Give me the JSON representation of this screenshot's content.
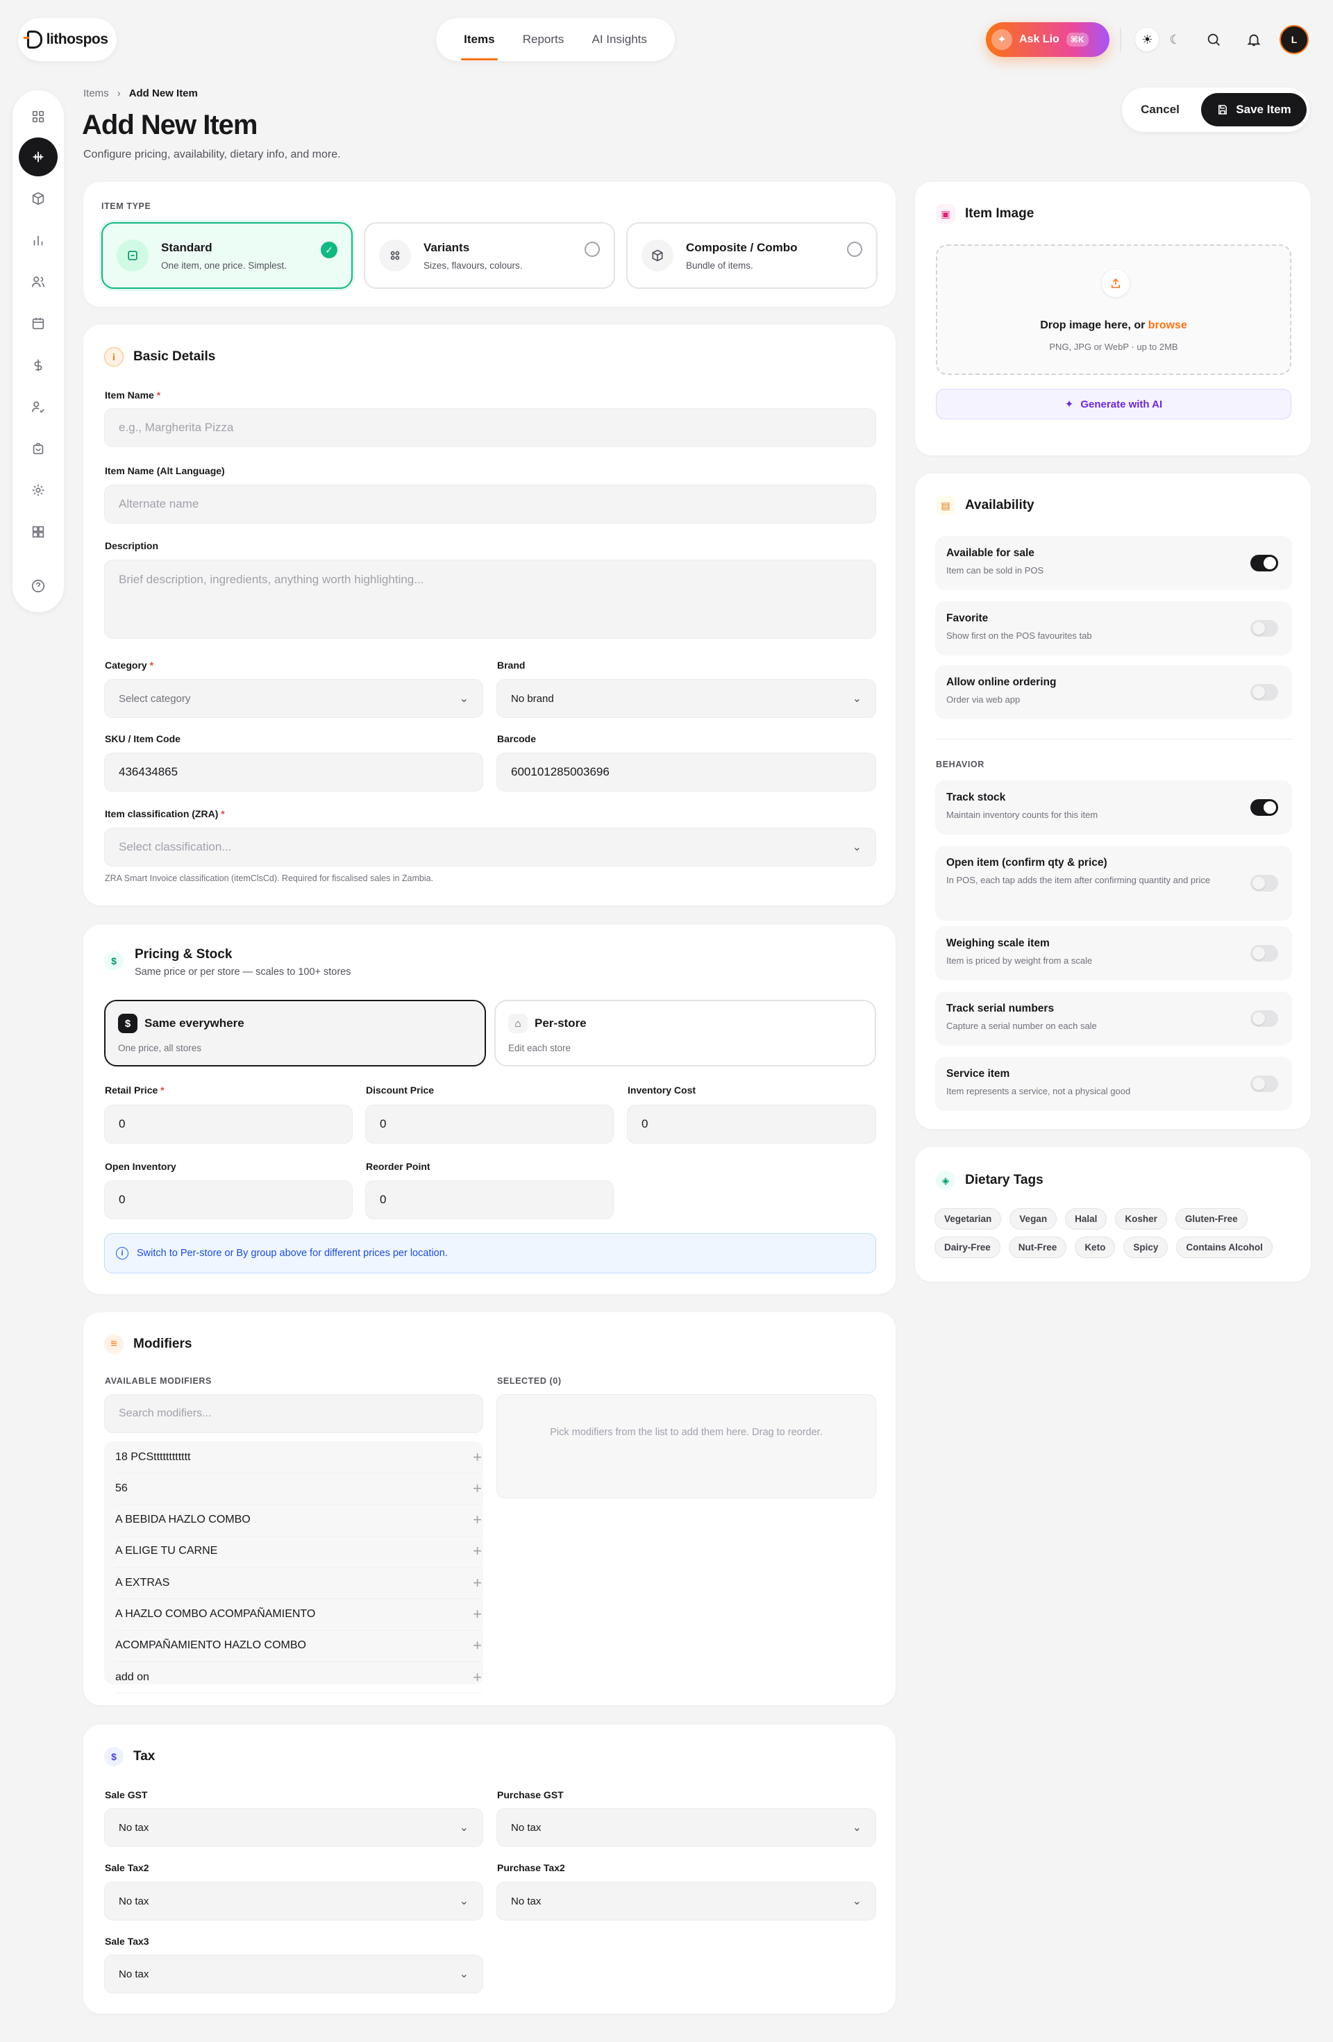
{
  "brand": {
    "name": "lithospos"
  },
  "nav": {
    "tabs": [
      {
        "label": "Items"
      },
      {
        "label": "Reports"
      },
      {
        "label": "AI Insights"
      }
    ]
  },
  "header": {
    "ask_label": "Ask Lio",
    "ask_shortcut": "⌘K",
    "avatar_initials": "L"
  },
  "breadcrumb": {
    "parent": "Items",
    "current": "Add New Item"
  },
  "page": {
    "title": "Add New Item",
    "subtitle": "Configure pricing, availability, dietary info, and more."
  },
  "actions": {
    "cancel": "Cancel",
    "save": "Save Item"
  },
  "item_type": {
    "heading": "ITEM TYPE",
    "options": [
      {
        "name": "Standard",
        "desc": "One item, one price. Simplest.",
        "selected": true
      },
      {
        "name": "Variants",
        "desc": "Sizes, flavours, colours."
      },
      {
        "name": "Composite / Combo",
        "desc": "Bundle of items."
      }
    ]
  },
  "basic": {
    "title": "Basic Details",
    "item_name_label": "Item Name",
    "item_name_ph": "e.g., Margherita Pizza",
    "alt_label": "Item Name (Alt Language)",
    "alt_ph": "Alternate name",
    "desc_label": "Description",
    "desc_ph": "Brief description, ingredients, anything worth highlighting...",
    "category_label": "Category",
    "category_ph": "Select category",
    "brand_label": "Brand",
    "brand_value": "No brand",
    "sku_label": "SKU / Item Code",
    "sku_value": "436434865",
    "barcode_label": "Barcode",
    "barcode_value": "600101285003696",
    "zra_label": "Item classification (ZRA)",
    "zra_ph": "Select classification...",
    "zra_hint": "ZRA Smart Invoice classification (itemClsCd). Required for fiscalised sales in Zambia."
  },
  "pricing": {
    "title": "Pricing & Stock",
    "subtitle": "Same price or per store — scales to 100+ stores",
    "mode_same": "Same everywhere",
    "mode_same_desc": "One price, all stores",
    "mode_store": "Per-store",
    "mode_store_desc": "Edit each store",
    "retail_label": "Retail Price",
    "retail_value": "0",
    "discount_label": "Discount Price",
    "discount_value": "0",
    "cost_label": "Inventory Cost",
    "cost_value": "0",
    "open_inv_label": "Open Inventory",
    "open_inv_value": "0",
    "reorder_label": "Reorder Point",
    "reorder_value": "0",
    "info": "Switch to Per-store or By group above for different prices per location."
  },
  "modifiers": {
    "title": "Modifiers",
    "available_heading": "AVAILABLE MODIFIERS",
    "search_ph": "Search modifiers...",
    "selected_heading": "SELECTED (0)",
    "empty_hint": "Pick modifiers from the list to add them here. Drag to reorder.",
    "items": [
      "18 PCStttttttttttt",
      "56",
      "A BEBIDA HAZLO COMBO",
      "A ELIGE TU CARNE",
      "A EXTRAS",
      "A HAZLO COMBO ACOMPAÑAMIENTO",
      "ACOMPAÑAMIENTO HAZLO COMBO",
      "add on"
    ]
  },
  "tax": {
    "title": "Tax",
    "sale_gst_label": "Sale GST",
    "sale_gst": "No tax",
    "purchase_gst_label": "Purchase GST",
    "purchase_gst": "No tax",
    "sale_tax2_label": "Sale Tax2",
    "sale_tax2": "No tax",
    "purchase_tax2_label": "Purchase Tax2",
    "purchase_tax2": "No tax",
    "sale_tax3_label": "Sale Tax3",
    "sale_tax3": "No tax"
  },
  "image": {
    "title": "Item Image",
    "drop": "Drop image here, or ",
    "browse": "browse",
    "hint": "PNG, JPG or WebP · up to 2MB",
    "ai_btn": "Generate with AI"
  },
  "availability": {
    "title": "Availability",
    "behavior_heading": "BEHAVIOR",
    "toggles": [
      {
        "title": "Available for sale",
        "desc": "Item can be sold in POS",
        "on": true
      },
      {
        "title": "Favorite",
        "desc": "Show first on the POS favourites tab",
        "on": false
      },
      {
        "title": "Allow online ordering",
        "desc": "Order via web app",
        "on": false
      }
    ],
    "behavior": [
      {
        "title": "Track stock",
        "desc": "Maintain inventory counts for this item",
        "on": true
      },
      {
        "title": "Open item (confirm qty & price)",
        "desc": "In POS, each tap adds the item after confirming quantity and price",
        "on": false
      },
      {
        "title": "Weighing scale item",
        "desc": "Item is priced by weight from a scale",
        "on": false
      },
      {
        "title": "Track serial numbers",
        "desc": "Capture a serial number on each sale",
        "on": false
      },
      {
        "title": "Service item",
        "desc": "Item represents a service, not a physical good",
        "on": false
      }
    ]
  },
  "dietary": {
    "title": "Dietary Tags",
    "tags": [
      "Vegetarian",
      "Vegan",
      "Halal",
      "Kosher",
      "Gluten-Free",
      "Dairy-Free",
      "Nut-Free",
      "Keto",
      "Spicy",
      "Contains Alcohol"
    ]
  },
  "colors": {
    "accent": "#f97316",
    "selected_green": "#10b981",
    "dark": "#18181b"
  }
}
